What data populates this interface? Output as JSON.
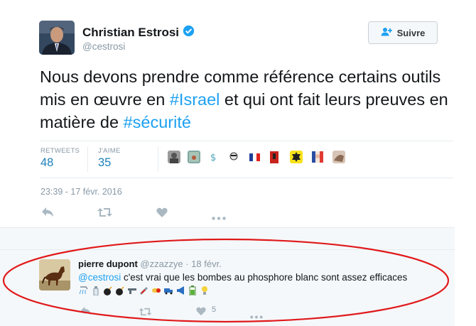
{
  "author": {
    "name": "Christian Estrosi",
    "handle": "@cestrosi",
    "verified": true
  },
  "follow_button": {
    "label": "Suivre",
    "icon": "add-user-icon"
  },
  "tweet": {
    "segments": [
      {
        "text": "Nous devons prendre comme référence certains outils mis en œuvre en ",
        "tag": false
      },
      {
        "text": "#Israel",
        "tag": true
      },
      {
        "text": " et qui ont fait leurs preuves en matière de ",
        "tag": false
      },
      {
        "text": "#sécurité",
        "tag": true
      }
    ]
  },
  "stats": {
    "retweets_label": "RETWEETS",
    "retweets_value": "48",
    "likes_label": "J'AIME",
    "likes_value": "35"
  },
  "likers_count": 10,
  "timestamp": "23:39 - 17 févr. 2016",
  "actions": [
    "reply-icon",
    "retweet-icon",
    "like-icon",
    "more-icon"
  ],
  "reply": {
    "name": "pierre dupont",
    "handle": "@zzazzye",
    "separator": "·",
    "date": "18 févr.",
    "mention": "@cestrosi",
    "text": " c'est vrai que les bombes au phosphore blanc sont assez efficaces",
    "emojis": [
      "shower",
      "lotion",
      "bomb",
      "bomb",
      "gun",
      "syringe",
      "pill",
      "truck",
      "megaphone",
      "battery",
      "lightbulb"
    ],
    "like_count": "5"
  },
  "colors": {
    "link": "#1da1f2",
    "stat": "#1b7fba",
    "muted": "#8899a6",
    "annotation": "#e0191b"
  }
}
